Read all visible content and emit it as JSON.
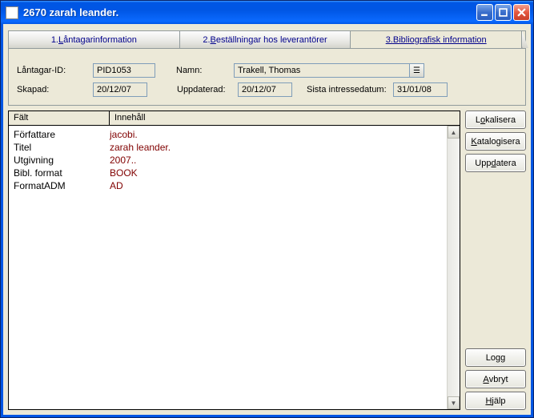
{
  "window": {
    "title": "2670 zarah leander."
  },
  "tabs": {
    "t1_num": "1. ",
    "t1_u": "L",
    "t1_rest": "åntagarinformation",
    "t2_num": "2. ",
    "t2_u": "B",
    "t2_rest": "eställningar hos leverantörer",
    "t3_num": "3. ",
    "t3_u": "B",
    "t3_rest": "ibliografisk information"
  },
  "form": {
    "lantagar_id_label": "Låntagar-ID:",
    "lantagar_id_value": "PID1053",
    "namn_label": "Namn:",
    "namn_value": "Trakell, Thomas",
    "skapad_label": "Skapad:",
    "skapad_value": "20/12/07",
    "uppdaterad_label": "Uppdaterad:",
    "uppdaterad_value": "20/12/07",
    "sista_label": "Sista intressedatum:",
    "sista_value": "31/01/08"
  },
  "grid": {
    "col_falt": "Fält",
    "col_innehall": "Innehåll",
    "rows": [
      {
        "f": "Författare",
        "v": "jacobi."
      },
      {
        "f": "Titel",
        "v": "zarah leander."
      },
      {
        "f": "Utgivning",
        "v": "2007.."
      },
      {
        "f": "Bibl. format",
        "v": "BOOK"
      },
      {
        "f": "FormatADM",
        "v": "AD"
      }
    ]
  },
  "buttons": {
    "lokalisera_pre": "L",
    "lokalisera_u": "o",
    "lokalisera_post": "kalisera",
    "katalogisera_u": "K",
    "katalogisera_post": "atalogisera",
    "uppdatera_pre": "Upp",
    "uppdatera_u": "d",
    "uppdatera_post": "atera",
    "logg": "Logg",
    "avbryt_u": "A",
    "avbryt_post": "vbryt",
    "hjalp_u": "H",
    "hjalp_post": "jälp"
  }
}
